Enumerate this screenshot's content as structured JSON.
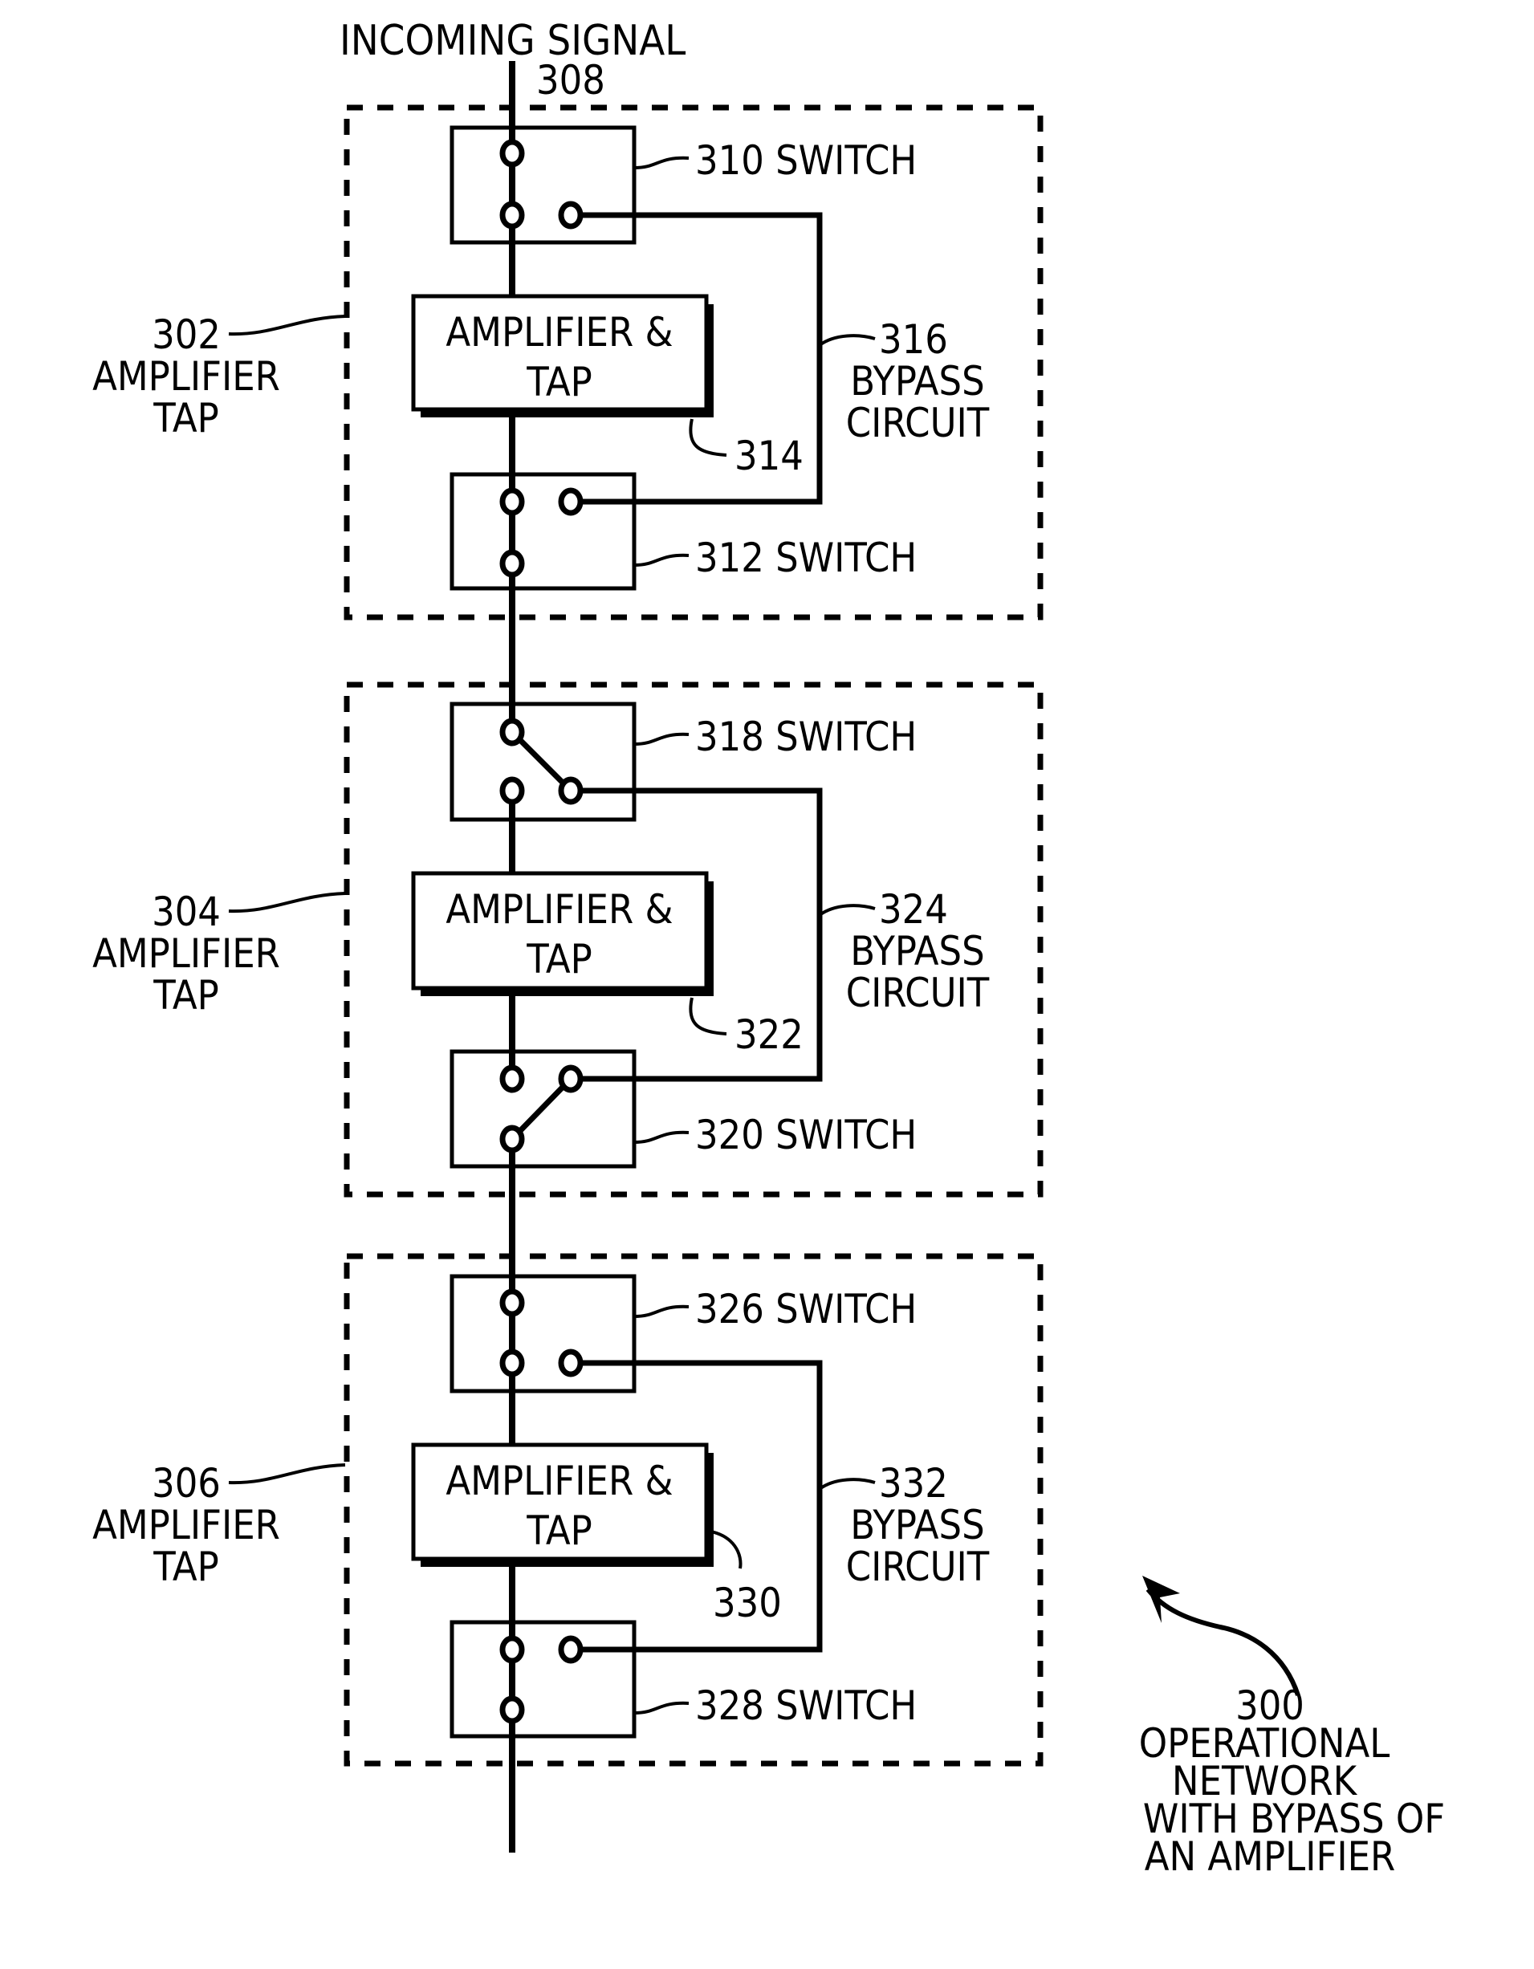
{
  "figure": {
    "incoming_signal": {
      "label": "INCOMING SIGNAL",
      "ref": "308"
    },
    "network": {
      "ref": "300",
      "lines": [
        "OPERATIONAL",
        "NETWORK",
        "WITH BYPASS OF",
        "AN AMPLIFIER"
      ]
    },
    "amplifier_taps": [
      {
        "ref": "302",
        "name_lines": [
          "AMPLIFIER",
          "TAP"
        ],
        "top_switch": {
          "ref": "310",
          "label": "310 SWITCH",
          "state": "through"
        },
        "amplifier": {
          "ref": "314",
          "lines": [
            "AMPLIFIER &",
            "TAP"
          ]
        },
        "bottom_switch": {
          "ref": "312",
          "label": "312 SWITCH",
          "state": "through"
        },
        "bypass": {
          "ref": "316",
          "lines": [
            "BYPASS",
            "CIRCUIT"
          ]
        }
      },
      {
        "ref": "304",
        "name_lines": [
          "AMPLIFIER",
          "TAP"
        ],
        "top_switch": {
          "ref": "318",
          "label": "318 SWITCH",
          "state": "bypass"
        },
        "amplifier": {
          "ref": "322",
          "lines": [
            "AMPLIFIER &",
            "TAP"
          ]
        },
        "bottom_switch": {
          "ref": "320",
          "label": "320 SWITCH",
          "state": "bypass"
        },
        "bypass": {
          "ref": "324",
          "lines": [
            "BYPASS",
            "CIRCUIT"
          ]
        }
      },
      {
        "ref": "306",
        "name_lines": [
          "AMPLIFIER",
          "TAP"
        ],
        "top_switch": {
          "ref": "326",
          "label": "326 SWITCH",
          "state": "through"
        },
        "amplifier": {
          "ref": "330",
          "lines": [
            "AMPLIFIER &",
            "TAP"
          ]
        },
        "bottom_switch": {
          "ref": "328",
          "label": "328 SWITCH",
          "state": "through"
        },
        "bypass": {
          "ref": "332",
          "lines": [
            "BYPASS",
            "CIRCUIT"
          ]
        }
      }
    ]
  }
}
